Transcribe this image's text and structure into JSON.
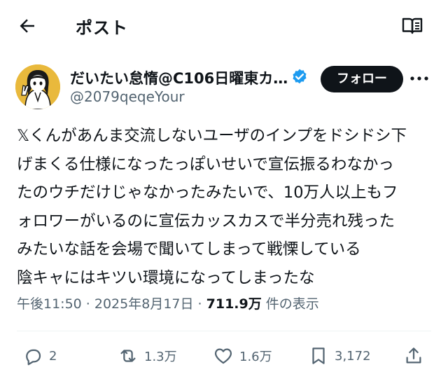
{
  "header": {
    "title": "ポスト"
  },
  "author": {
    "display_name": "だいたい怠惰@C106日曜東カ…",
    "handle": "@2079qeqeYour",
    "follow_label": "フォロー"
  },
  "post": {
    "lines": [
      "𝕏くんがあんま交流しないユーザのインプをドシドシ下",
      "げまくる仕様になったっぽいせいで宣伝振るわなかっ",
      "たのウチだけじゃなかったみたいで、10万人以上もフ",
      "ォロワーがいるのに宣伝カッスカスで半分売れ残った",
      "みたいな話を会場で聞いてしまって戦慄している",
      "陰キャにはキツい環境になってしまったな"
    ],
    "timestamp": "午後11:50 · 2025年8月17日 · ",
    "views_count": "711.9万",
    "views_label": " 件の表示"
  },
  "actions": {
    "replies": "2",
    "reposts": "1.3万",
    "likes": "1.6万",
    "bookmarks": "3,172"
  },
  "colors": {
    "text": "#0f1419",
    "muted": "#536471",
    "verified": "#1d9bf0",
    "avatar_bg": "#e9b93c"
  }
}
